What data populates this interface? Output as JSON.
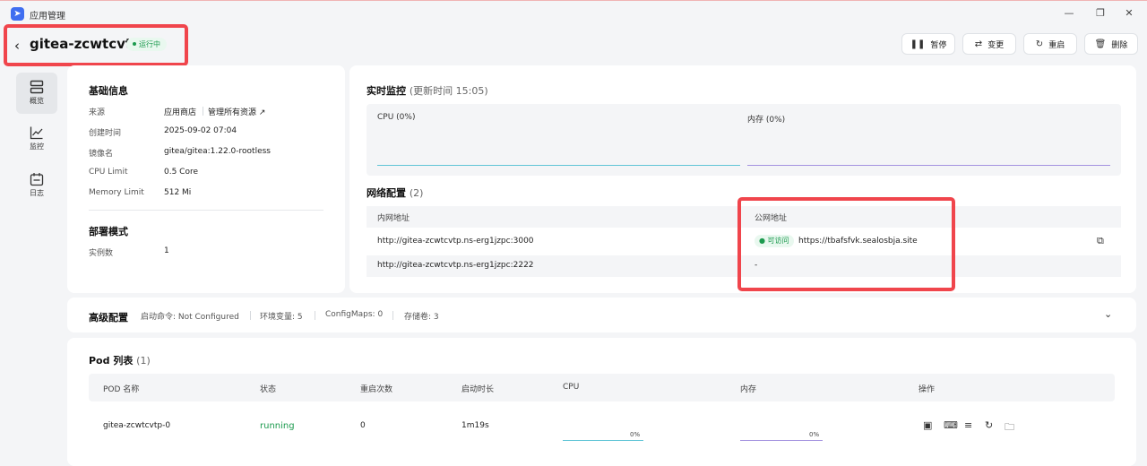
{
  "window": {
    "title": "应用管理"
  },
  "header": {
    "app_name": "gitea-zcwtcvtp",
    "status": "运行中",
    "actions": [
      {
        "label": "暂停",
        "icon": "pause-icon"
      },
      {
        "label": "变更",
        "icon": "swap-icon"
      },
      {
        "label": "重启",
        "icon": "restart-icon"
      },
      {
        "label": "删除",
        "icon": "trash-icon"
      }
    ]
  },
  "sidebar": {
    "items": [
      {
        "label": "概览",
        "icon": "server-icon",
        "active": true
      },
      {
        "label": "监控",
        "icon": "chart-line-icon",
        "active": false
      },
      {
        "label": "日志",
        "icon": "calendar-log-icon",
        "active": false
      }
    ]
  },
  "basic_info": {
    "title": "基础信息",
    "rows": [
      {
        "key": "来源",
        "value": "应用商店",
        "link": "管理所有资源"
      },
      {
        "key": "创建时间",
        "value": "2025-09-02 07:04"
      },
      {
        "key": "镜像名",
        "value": "gitea/gitea:1.22.0-rootless"
      },
      {
        "key": "CPU Limit",
        "value": "0.5 Core"
      },
      {
        "key": "Memory Limit",
        "value": "512 Mi"
      }
    ],
    "deploy_title": "部署模式",
    "deploy_rows": [
      {
        "key": "实例数",
        "value": "1"
      }
    ]
  },
  "monitor": {
    "title": "实时监控",
    "subtitle": "(更新时间  15:05)",
    "cpu_label": "CPU  (0%)",
    "mem_label": "内存  (0%)",
    "cpu_color": "#5fc4d6",
    "mem_color": "#a493e0"
  },
  "network": {
    "title": "网络配置",
    "count": "(2)",
    "col_internal": "内网地址",
    "col_public": "公网地址",
    "rows": [
      {
        "internal": "http://gitea-zcwtcvtp.ns-erg1jzpc:3000",
        "badge": "可访问",
        "public": "https://tbafsfvk.sealosbja.site"
      },
      {
        "internal": "http://gitea-zcwtcvtp.ns-erg1jzpc:2222",
        "badge": "",
        "public": "-"
      }
    ]
  },
  "advanced": {
    "title": "高级配置",
    "items": [
      "启动命令: Not Configured",
      "环境变量: 5",
      "ConfigMaps: 0",
      "存储卷: 3"
    ]
  },
  "pods": {
    "title": "Pod 列表",
    "count": "(1)",
    "headers": [
      "POD 名称",
      "状态",
      "重启次数",
      "启动时长",
      "CPU",
      "内存",
      "操作"
    ],
    "rows": [
      {
        "name": "gitea-zcwtcvtp-0",
        "status": "running",
        "restarts": "0",
        "uptime": "1m19s",
        "cpu": "0%",
        "mem": "0%"
      }
    ],
    "row_actions": [
      "calendar-icon",
      "terminal-icon",
      "list-icon",
      "restart-icon",
      "folder-icon"
    ]
  },
  "colors": {
    "accent_green": "#1c9a4e",
    "highlight_red": "#f0454c"
  }
}
